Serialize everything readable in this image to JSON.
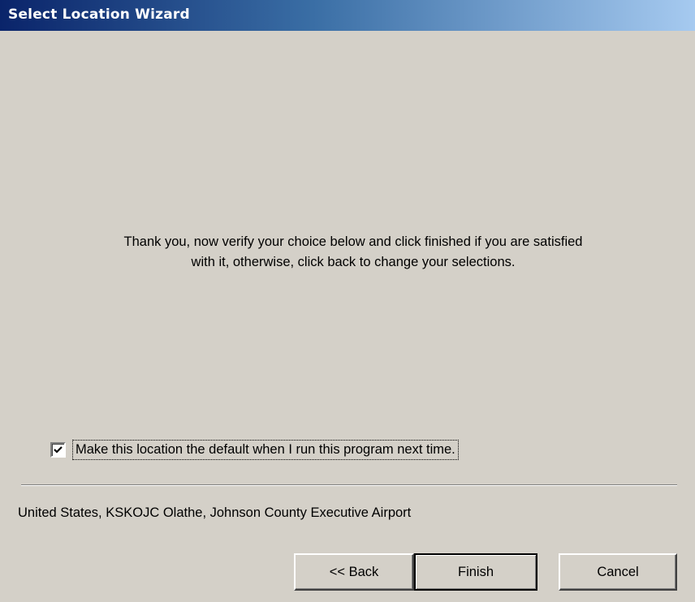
{
  "window": {
    "title": "Select Location Wizard"
  },
  "message": {
    "line1": "Thank you, now verify your choice below and click finished if you are satisfied",
    "line2": "with it, otherwise, click back to change your selections."
  },
  "default_checkbox": {
    "checked": true,
    "label": "Make this location the default when I run this program next time."
  },
  "location_text": "United States, KSKOJC Olathe, Johnson County Executive Airport",
  "buttons": {
    "back": "<< Back",
    "finish": "Finish",
    "cancel": "Cancel"
  },
  "icons": {
    "checkbox_mark": "checkmark-icon"
  },
  "colors": {
    "titlebar_start": "#0a246a",
    "titlebar_end": "#a6caf0",
    "dialog_background": "#d4d0c8"
  }
}
